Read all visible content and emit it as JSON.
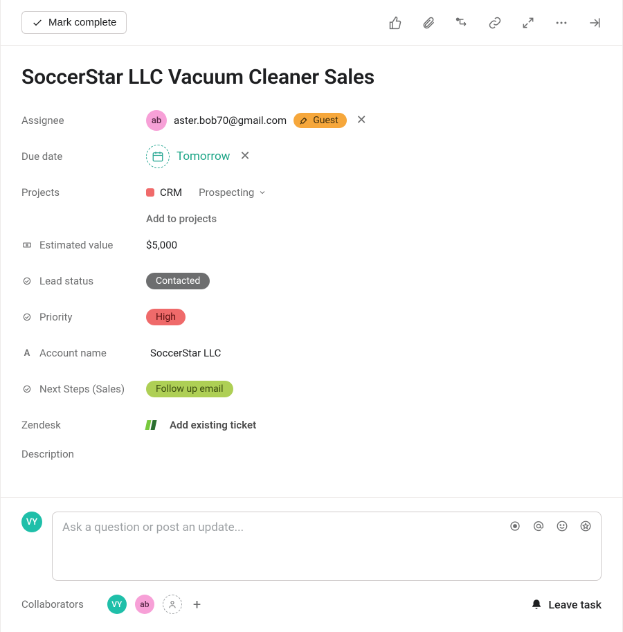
{
  "toolbar": {
    "mark_complete": "Mark complete"
  },
  "task": {
    "title": "SoccerStar LLC Vacuum Cleaner Sales"
  },
  "labels": {
    "assignee": "Assignee",
    "due_date": "Due date",
    "projects": "Projects",
    "estimated_value": "Estimated value",
    "lead_status": "Lead status",
    "priority": "Priority",
    "account_name": "Account name",
    "next_steps": "Next Steps (Sales)",
    "zendesk": "Zendesk",
    "description": "Description",
    "collaborators": "Collaborators"
  },
  "assignee": {
    "initials": "ab",
    "email": "aster.bob70@gmail.com",
    "guest_label": "Guest"
  },
  "due_date": {
    "text": "Tomorrow"
  },
  "project": {
    "name": "CRM",
    "stage": "Prospecting",
    "add_label": "Add to projects"
  },
  "fields": {
    "estimated_value": "$5,000",
    "lead_status": "Contacted",
    "priority": "High",
    "account_name": "SoccerStar LLC",
    "next_steps": "Follow up email"
  },
  "zendesk": {
    "add_label": "Add existing ticket"
  },
  "comment": {
    "placeholder": "Ask a question or post an update..."
  },
  "footer": {
    "collab1": "VY",
    "collab2": "ab",
    "leave_task": "Leave task",
    "current_user_initials": "VY"
  }
}
